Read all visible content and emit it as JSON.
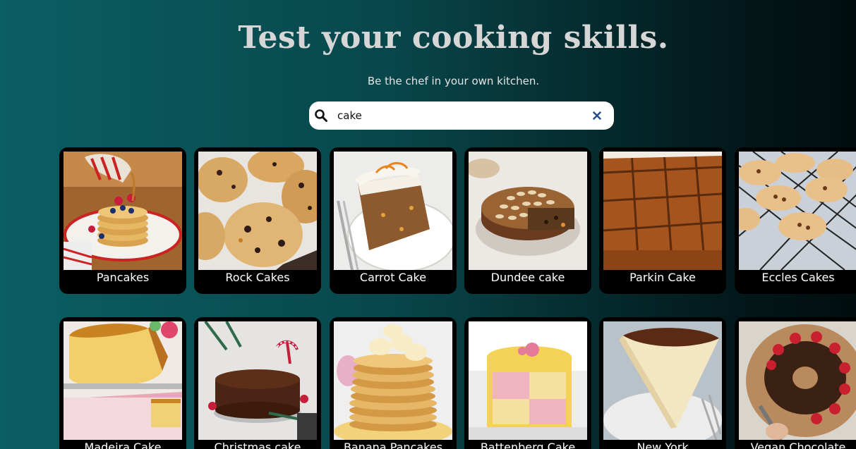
{
  "header": {
    "title": "Test your cooking skills.",
    "subtitle": "Be the chef in your own kitchen."
  },
  "search": {
    "value": "cake",
    "icon": "search-icon",
    "clear_icon": "close-icon"
  },
  "recipes": [
    {
      "label": "Pancakes",
      "image": "pancakes-photo"
    },
    {
      "label": "Rock Cakes",
      "image": "rock-cakes-photo"
    },
    {
      "label": "Carrot Cake",
      "image": "carrot-cake-photo"
    },
    {
      "label": "Dundee cake",
      "image": "dundee-cake-photo"
    },
    {
      "label": "Parkin Cake",
      "image": "parkin-cake-photo"
    },
    {
      "label": "Eccles Cakes",
      "image": "eccles-cakes-photo"
    },
    {
      "label": "Madeira Cake",
      "image": "madeira-cake-photo"
    },
    {
      "label": "Christmas cake",
      "image": "christmas-cake-photo"
    },
    {
      "label": "Banana Pancakes",
      "image": "banana-pancakes-photo"
    },
    {
      "label": "Battenberg Cake",
      "image": "battenberg-cake-photo"
    },
    {
      "label": "New York",
      "image": "new-york-cheesecake-photo"
    },
    {
      "label": "Vegan Chocolate",
      "image": "vegan-chocolate-cake-photo"
    }
  ],
  "colors": {
    "background_start": "#0a5f63",
    "background_end": "#010d0e",
    "card": "#000000",
    "title": "#d6d6d6"
  }
}
